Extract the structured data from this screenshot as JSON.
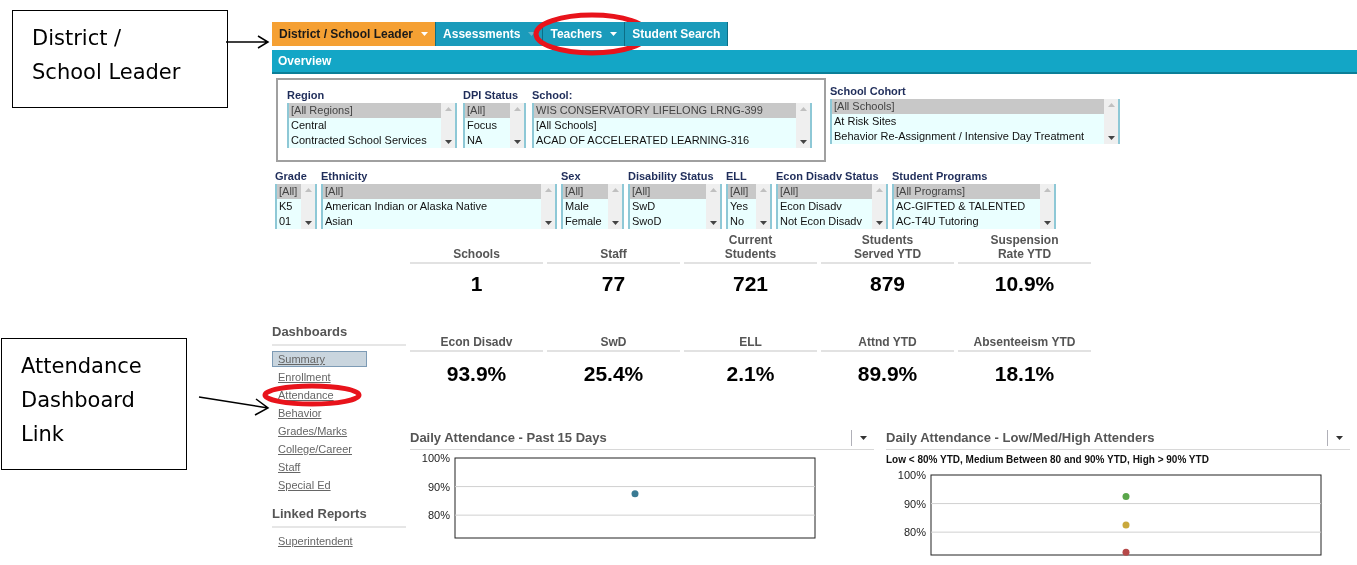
{
  "callouts": [
    {
      "lines": [
        "District /",
        "School Leader"
      ]
    },
    {
      "lines": [
        "Attendance",
        "Dashboard",
        "Link"
      ]
    }
  ],
  "nav": [
    {
      "label": "District / School Leader",
      "selected": true,
      "menu": true,
      "circled": false
    },
    {
      "label": "Assessments",
      "selected": false,
      "menu": true,
      "circled": false
    },
    {
      "label": "Teachers",
      "selected": false,
      "menu": true,
      "circled": true
    },
    {
      "label": "Student Search",
      "selected": false,
      "menu": false,
      "circled": false
    }
  ],
  "overview": {
    "title": "Overview"
  },
  "filters_top": [
    {
      "label": "Region",
      "items": [
        {
          "text": "[All Regions]",
          "selected": true
        },
        {
          "text": "Central",
          "selected": false
        },
        {
          "text": "Contracted School Services",
          "selected": false
        }
      ]
    },
    {
      "label": "DPI Status",
      "items": [
        {
          "text": "[All]",
          "selected": true
        },
        {
          "text": "Focus",
          "selected": false
        },
        {
          "text": "NA",
          "selected": false
        }
      ]
    },
    {
      "label": "School:",
      "items": [
        {
          "text": "WIS CONSERVATORY LIFELONG LRNG-399",
          "selected": true
        },
        {
          "text": "[All Schools]",
          "selected": false
        },
        {
          "text": "ACAD OF ACCELERATED LEARNING-316",
          "selected": false
        }
      ]
    }
  ],
  "school_cohort": {
    "label": "School Cohort",
    "items": [
      {
        "text": "[All Schools]",
        "selected": true
      },
      {
        "text": "At Risk Sites",
        "selected": false
      },
      {
        "text": "Behavior Re-Assignment / Intensive Day Treatment",
        "selected": false
      }
    ]
  },
  "filters_bottom": [
    {
      "label": "Grade",
      "items": [
        {
          "text": "[All]",
          "selected": true
        },
        {
          "text": "K5",
          "selected": false
        },
        {
          "text": "01",
          "selected": false
        }
      ]
    },
    {
      "label": "Ethnicity",
      "items": [
        {
          "text": "[All]",
          "selected": true
        },
        {
          "text": "American Indian or Alaska Native",
          "selected": false
        },
        {
          "text": "Asian",
          "selected": false
        }
      ]
    },
    {
      "label": "Sex",
      "items": [
        {
          "text": "[All]",
          "selected": true
        },
        {
          "text": "Male",
          "selected": false
        },
        {
          "text": "Female",
          "selected": false
        }
      ]
    },
    {
      "label": "Disability Status",
      "items": [
        {
          "text": "[All]",
          "selected": true
        },
        {
          "text": "SwD",
          "selected": false
        },
        {
          "text": "SwoD",
          "selected": false
        }
      ]
    },
    {
      "label": "ELL",
      "items": [
        {
          "text": "[All]",
          "selected": true
        },
        {
          "text": "Yes",
          "selected": false
        },
        {
          "text": "No",
          "selected": false
        }
      ]
    },
    {
      "label": "Econ Disadv Status",
      "items": [
        {
          "text": "[All]",
          "selected": true
        },
        {
          "text": "Econ Disadv",
          "selected": false
        },
        {
          "text": "Not Econ Disadv",
          "selected": false
        }
      ]
    },
    {
      "label": "Student Programs",
      "items": [
        {
          "text": "[All Programs]",
          "selected": true
        },
        {
          "text": "AC-GIFTED & TALENTED",
          "selected": false
        },
        {
          "text": "AC-T4U Tutoring",
          "selected": false
        }
      ]
    }
  ],
  "kpis_top": [
    {
      "label_lines": [
        "Schools"
      ],
      "value": "1"
    },
    {
      "label_lines": [
        "Staff"
      ],
      "value": "77"
    },
    {
      "label_lines": [
        "Current",
        "Students"
      ],
      "value": "721"
    },
    {
      "label_lines": [
        "Students",
        "Served YTD"
      ],
      "value": "879"
    },
    {
      "label_lines": [
        "Suspension",
        "Rate YTD"
      ],
      "value": "10.9%"
    }
  ],
  "sidebar": [
    {
      "title": "Dashboards",
      "links": [
        {
          "label": "Summary",
          "selected": true,
          "circled": false
        },
        {
          "label": "Enrollment",
          "selected": false,
          "circled": false
        },
        {
          "label": "Attendance",
          "selected": false,
          "circled": true
        },
        {
          "label": "Behavior",
          "selected": false,
          "circled": false
        },
        {
          "label": "Grades/Marks",
          "selected": false,
          "circled": false
        },
        {
          "label": "College/Career",
          "selected": false,
          "circled": false
        },
        {
          "label": "Staff",
          "selected": false,
          "circled": false
        },
        {
          "label": "Special Ed",
          "selected": false,
          "circled": false
        }
      ]
    },
    {
      "title": "Linked Reports",
      "links": [
        {
          "label": "Superintendent",
          "selected": false,
          "circled": false
        }
      ]
    }
  ],
  "kpis_bottom": [
    {
      "label_lines": [
        "Econ Disadv"
      ],
      "value": "93.9%"
    },
    {
      "label_lines": [
        "SwD"
      ],
      "value": "25.4%"
    },
    {
      "label_lines": [
        "ELL"
      ],
      "value": "2.1%"
    },
    {
      "label_lines": [
        "Attnd YTD"
      ],
      "value": "89.9%"
    },
    {
      "label_lines": [
        "Absenteeism YTD"
      ],
      "value": "18.1%"
    }
  ],
  "charts": [
    {
      "title": "Daily Attendance - Past 15 Days",
      "chart_data": {
        "type": "scatter",
        "yticks": [
          {
            "value": 100,
            "label": "100%"
          },
          {
            "value": 90,
            "label": "90%"
          },
          {
            "value": 80,
            "label": "80%"
          }
        ],
        "ylim": [
          72,
          100
        ],
        "series": [
          {
            "color": "#3a7a93",
            "values": [
              87.5
            ]
          }
        ]
      }
    },
    {
      "title": "Daily Attendance - Low/Med/High Attenders",
      "subtitle": "Low < 80% YTD, Medium Between 80 and 90% YTD, High > 90% YTD",
      "chart_data": {
        "type": "scatter",
        "yticks": [
          {
            "value": 100,
            "label": "100%"
          },
          {
            "value": 90,
            "label": "90%"
          },
          {
            "value": 80,
            "label": "80%"
          }
        ],
        "ylim": [
          72,
          100
        ],
        "series": [
          {
            "color": "#5aa64a",
            "values": [
              92.5
            ]
          },
          {
            "color": "#c9a83c",
            "values": [
              82.5
            ]
          },
          {
            "color": "#b54848",
            "values": [
              73
            ]
          }
        ]
      }
    }
  ]
}
